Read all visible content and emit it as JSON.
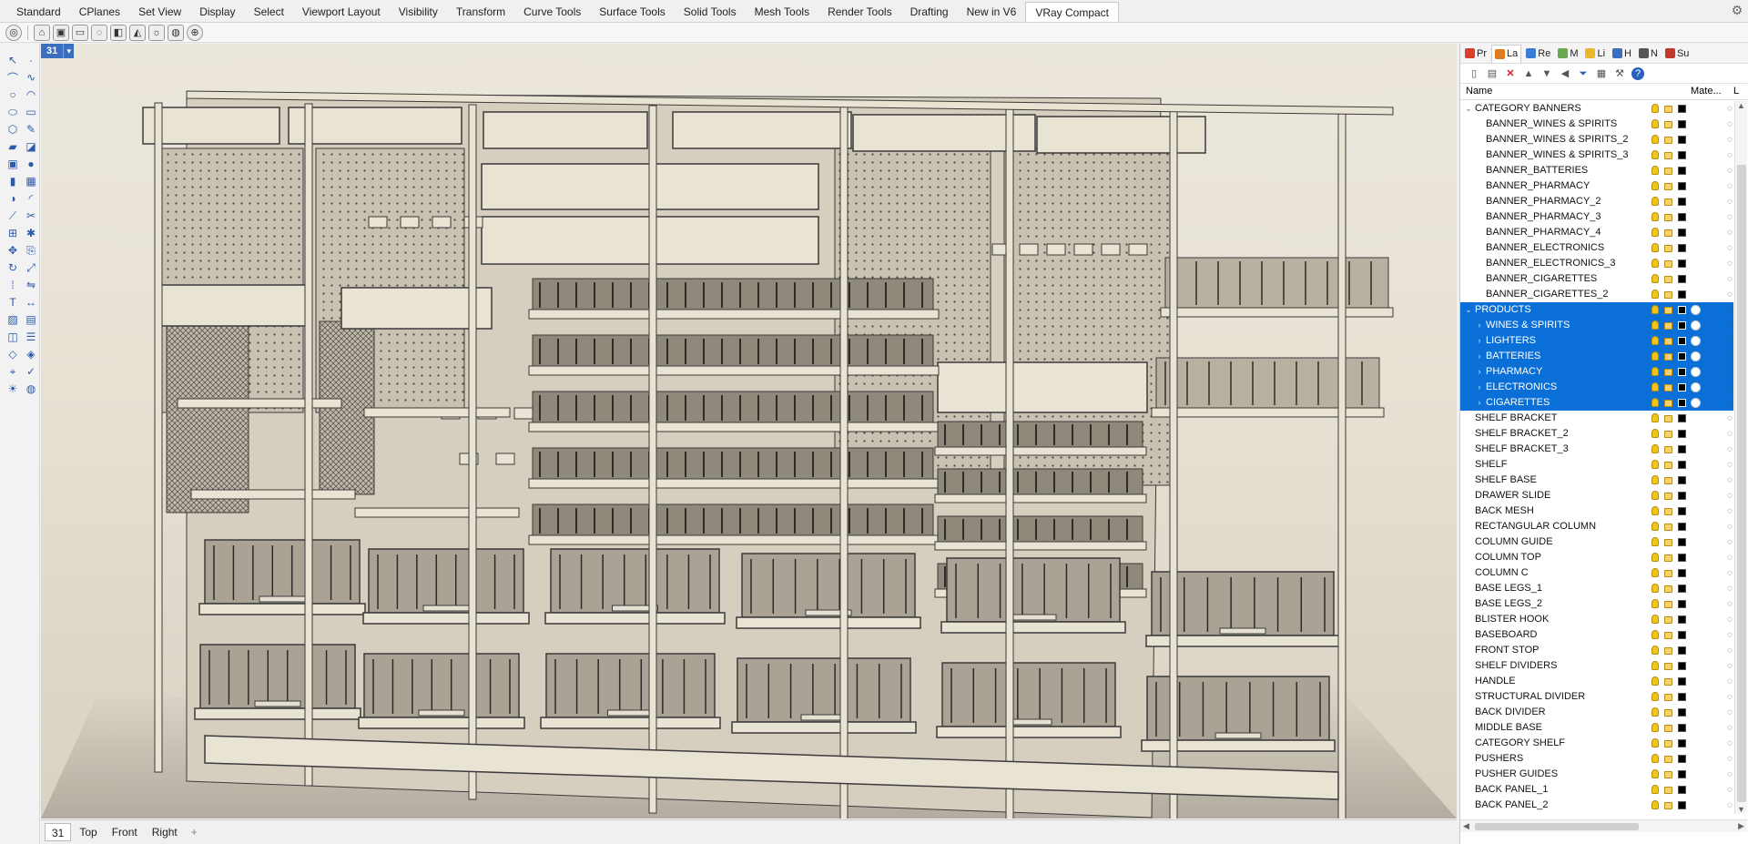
{
  "toolbar_tabs": [
    {
      "label": "Standard",
      "active": false
    },
    {
      "label": "CPlanes",
      "active": false
    },
    {
      "label": "Set View",
      "active": false
    },
    {
      "label": "Display",
      "active": false
    },
    {
      "label": "Select",
      "active": false
    },
    {
      "label": "Viewport Layout",
      "active": false
    },
    {
      "label": "Visibility",
      "active": false
    },
    {
      "label": "Transform",
      "active": false
    },
    {
      "label": "Curve Tools",
      "active": false
    },
    {
      "label": "Surface Tools",
      "active": false
    },
    {
      "label": "Solid Tools",
      "active": false
    },
    {
      "label": "Mesh Tools",
      "active": false
    },
    {
      "label": "Render Tools",
      "active": false
    },
    {
      "label": "Drafting",
      "active": false
    },
    {
      "label": "New in V6",
      "active": false
    },
    {
      "label": "VRay Compact",
      "active": true
    }
  ],
  "viewport": {
    "label": "31",
    "arrow": "▾"
  },
  "viewport_tabs": [
    {
      "label": "31",
      "active": true
    },
    {
      "label": "Top",
      "active": false
    },
    {
      "label": "Front",
      "active": false
    },
    {
      "label": "Right",
      "active": false
    }
  ],
  "viewport_add": "+",
  "panel": {
    "tabs": [
      {
        "label": "Pr",
        "color": "#d9402b"
      },
      {
        "label": "La",
        "color": "#e07b1c"
      },
      {
        "label": "Re",
        "color": "#3a7bd5"
      },
      {
        "label": "M",
        "color": "#6aa84f"
      },
      {
        "label": "Li",
        "color": "#e8b92d"
      },
      {
        "label": "H",
        "color": "#3a6fc0"
      },
      {
        "label": "N",
        "color": "#555555"
      },
      {
        "label": "Su",
        "color": "#c0392b"
      }
    ],
    "active_tab": "La",
    "header": {
      "name": "Name",
      "material": "Mate...",
      "last": "L"
    },
    "layers": [
      {
        "name": "CATEGORY BANNERS",
        "level": 0,
        "expand": "v",
        "selected": false
      },
      {
        "name": "BANNER_WINES & SPIRITS",
        "level": 1,
        "expand": "",
        "selected": false
      },
      {
        "name": "BANNER_WINES & SPIRITS_2",
        "level": 1,
        "expand": "",
        "selected": false
      },
      {
        "name": "BANNER_WINES & SPIRITS_3",
        "level": 1,
        "expand": "",
        "selected": false
      },
      {
        "name": "BANNER_BATTERIES",
        "level": 1,
        "expand": "",
        "selected": false
      },
      {
        "name": "BANNER_PHARMACY",
        "level": 1,
        "expand": "",
        "selected": false
      },
      {
        "name": "BANNER_PHARMACY_2",
        "level": 1,
        "expand": "",
        "selected": false
      },
      {
        "name": "BANNER_PHARMACY_3",
        "level": 1,
        "expand": "",
        "selected": false
      },
      {
        "name": "BANNER_PHARMACY_4",
        "level": 1,
        "expand": "",
        "selected": false
      },
      {
        "name": "BANNER_ELECTRONICS",
        "level": 1,
        "expand": "",
        "selected": false
      },
      {
        "name": "BANNER_ELECTRONICS_3",
        "level": 1,
        "expand": "",
        "selected": false
      },
      {
        "name": "BANNER_CIGARETTES",
        "level": 1,
        "expand": "",
        "selected": false
      },
      {
        "name": "BANNER_CIGARETTES_2",
        "level": 1,
        "expand": "",
        "selected": false
      },
      {
        "name": "PRODUCTS",
        "level": 0,
        "expand": "v",
        "selected": true
      },
      {
        "name": "WINES & SPIRITS",
        "level": 1,
        "expand": ">",
        "selected": true
      },
      {
        "name": "LIGHTERS",
        "level": 1,
        "expand": ">",
        "selected": true
      },
      {
        "name": "BATTERIES",
        "level": 1,
        "expand": ">",
        "selected": true
      },
      {
        "name": "PHARMACY",
        "level": 1,
        "expand": ">",
        "selected": true
      },
      {
        "name": "ELECTRONICS",
        "level": 1,
        "expand": ">",
        "selected": true
      },
      {
        "name": "CIGARETTES",
        "level": 1,
        "expand": ">",
        "selected": true
      },
      {
        "name": "SHELF BRACKET",
        "level": 0,
        "expand": "",
        "selected": false
      },
      {
        "name": "SHELF BRACKET_2",
        "level": 0,
        "expand": "",
        "selected": false
      },
      {
        "name": "SHELF BRACKET_3",
        "level": 0,
        "expand": "",
        "selected": false
      },
      {
        "name": "SHELF",
        "level": 0,
        "expand": "",
        "selected": false
      },
      {
        "name": "SHELF BASE",
        "level": 0,
        "expand": "",
        "selected": false
      },
      {
        "name": "DRAWER SLIDE",
        "level": 0,
        "expand": "",
        "selected": false
      },
      {
        "name": "BACK MESH",
        "level": 0,
        "expand": "",
        "selected": false
      },
      {
        "name": "RECTANGULAR COLUMN",
        "level": 0,
        "expand": "",
        "selected": false
      },
      {
        "name": "COLUMN GUIDE",
        "level": 0,
        "expand": "",
        "selected": false
      },
      {
        "name": "COLUMN TOP",
        "level": 0,
        "expand": "",
        "selected": false
      },
      {
        "name": "COLUMN C",
        "level": 0,
        "expand": "",
        "selected": false
      },
      {
        "name": "BASE LEGS_1",
        "level": 0,
        "expand": "",
        "selected": false
      },
      {
        "name": "BASE LEGS_2",
        "level": 0,
        "expand": "",
        "selected": false
      },
      {
        "name": "BLISTER HOOK",
        "level": 0,
        "expand": "",
        "selected": false
      },
      {
        "name": "BASEBOARD",
        "level": 0,
        "expand": "",
        "selected": false
      },
      {
        "name": "FRONT STOP",
        "level": 0,
        "expand": "",
        "selected": false
      },
      {
        "name": "SHELF DIVIDERS",
        "level": 0,
        "expand": "",
        "selected": false
      },
      {
        "name": "HANDLE",
        "level": 0,
        "expand": "",
        "selected": false
      },
      {
        "name": "STRUCTURAL DIVIDER",
        "level": 0,
        "expand": "",
        "selected": false
      },
      {
        "name": "BACK DIVIDER",
        "level": 0,
        "expand": "",
        "selected": false
      },
      {
        "name": "MIDDLE BASE",
        "level": 0,
        "expand": "",
        "selected": false
      },
      {
        "name": "CATEGORY SHELF",
        "level": 0,
        "expand": "",
        "selected": false
      },
      {
        "name": "PUSHERS",
        "level": 0,
        "expand": "",
        "selected": false
      },
      {
        "name": "PUSHER GUIDES",
        "level": 0,
        "expand": "",
        "selected": false
      },
      {
        "name": "BACK PANEL_1",
        "level": 0,
        "expand": "",
        "selected": false
      },
      {
        "name": "BACK PANEL_2",
        "level": 0,
        "expand": "",
        "selected": false
      }
    ]
  },
  "colors": {
    "selection": "#0a70d8",
    "viewport_label": "#3a6fc0",
    "scene_background": "#e7e1d4",
    "model_panel": "#e9e3d3",
    "model_line": "#3b3b3b"
  }
}
